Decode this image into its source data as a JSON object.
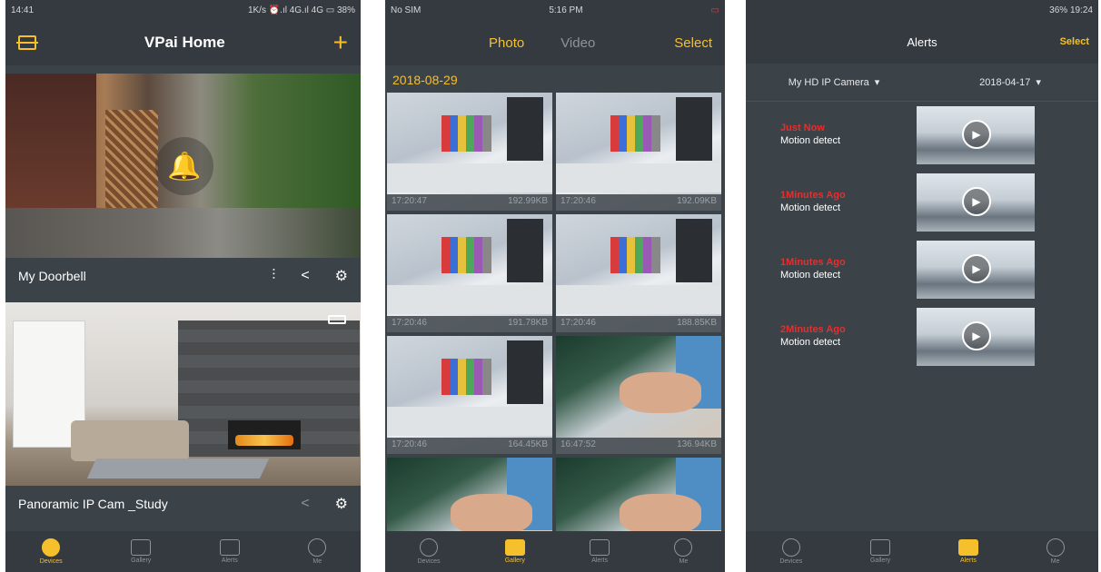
{
  "phone1": {
    "status": {
      "time": "14:41",
      "right": "1K/s ⏰.ıl 4G.ıl 4G ▭ 38%"
    },
    "nav": {
      "title": "VPai Home"
    },
    "cameras": [
      {
        "name": "My Doorbell"
      },
      {
        "name": "Panoramic IP Cam _Study"
      }
    ],
    "tabs": [
      {
        "label": "Devices",
        "icon": "devices-icon"
      },
      {
        "label": "Gallery",
        "icon": "gallery-icon"
      },
      {
        "label": "Alerts",
        "icon": "alerts-icon"
      },
      {
        "label": "Me",
        "icon": "me-icon"
      }
    ],
    "active_tab": "Devices"
  },
  "phone2": {
    "status": {
      "left": "No SIM",
      "time": "5:16 PM"
    },
    "nav": {
      "photo": "Photo",
      "video": "Video",
      "select": "Select"
    },
    "date": "2018-08-29",
    "items": [
      {
        "time": "17:20:47",
        "size": "192.99KB"
      },
      {
        "time": "17:20:46",
        "size": "192.09KB"
      },
      {
        "time": "17:20:46",
        "size": "191.78KB"
      },
      {
        "time": "17:20:46",
        "size": "188.85KB"
      },
      {
        "time": "17:20:46",
        "size": "164.45KB"
      },
      {
        "time": "16:47:52",
        "size": "136.94KB"
      }
    ],
    "tabs": [
      {
        "label": "Devices"
      },
      {
        "label": "Gallery"
      },
      {
        "label": "Alerts"
      },
      {
        "label": "Me"
      }
    ],
    "active_tab": "Gallery"
  },
  "phone3": {
    "status": {
      "right": "36% 19:24"
    },
    "nav": {
      "title": "Alerts",
      "select": "Select"
    },
    "filters": {
      "camera": "My HD IP Camera",
      "date": "2018-04-17"
    },
    "alerts": [
      {
        "when": "Just Now",
        "type": "Motion detect"
      },
      {
        "when": "1Minutes Ago",
        "type": "Motion detect"
      },
      {
        "when": "1Minutes Ago",
        "type": "Motion detect"
      },
      {
        "when": "2Minutes Ago",
        "type": "Motion detect"
      }
    ],
    "tabs": [
      {
        "label": "Devices"
      },
      {
        "label": "Gallery"
      },
      {
        "label": "Alerts"
      },
      {
        "label": "Me"
      }
    ],
    "active_tab": "Alerts"
  },
  "colors": {
    "accent": "#f5c02b",
    "background": "#3b4248",
    "bar": "#343a40",
    "alert_red": "#e52f2f"
  }
}
